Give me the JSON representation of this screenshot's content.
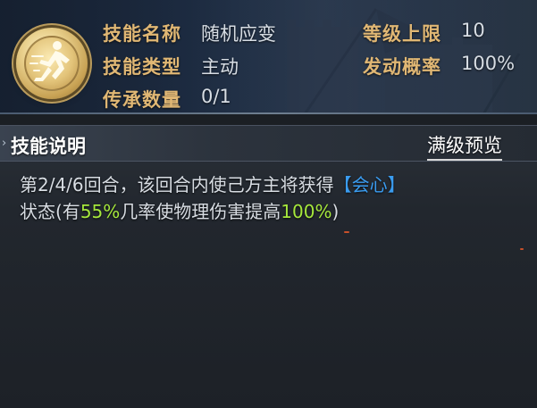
{
  "skill": {
    "icon": "running-figure-icon",
    "name_label": "技能名称",
    "name_value": "随机应变",
    "type_label": "技能类型",
    "type_value": "主动",
    "inherit_label": "传承数量",
    "inherit_value": "0/1",
    "level_cap_label": "等级上限",
    "level_cap_value": "10",
    "trigger_rate_label": "发动概率",
    "trigger_rate_value": "100%"
  },
  "description": {
    "section_title": "技能说明",
    "preview_label": "满级预览",
    "line1_text": "第2/4/6回合，该回合内使己方主将获得",
    "line1_keyword": "【会心】",
    "line2_prefix": "状态(有",
    "line2_value1": "55%",
    "line2_mid": "几率使物理伤害提高",
    "line2_value2": "100%",
    "line2_suffix": ")"
  },
  "colors": {
    "label_gold": "#e0b774",
    "value_text": "#d7dde4",
    "keyword_blue": "#3a9cf0",
    "highlight_green": "#a6e83c"
  }
}
